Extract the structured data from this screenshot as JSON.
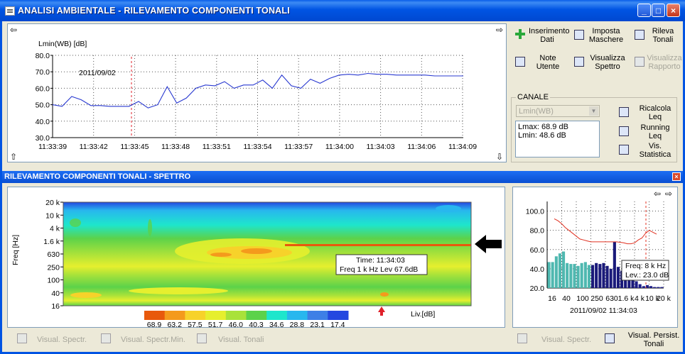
{
  "window": {
    "title": "ANALISI AMBIENTALE - RILEVAMENTO COMPONENTI TONALI",
    "minimize_label": "_",
    "maximize_label": "□",
    "close_label": "×"
  },
  "time_chart": {
    "ylabel": "Lmin(WB) [dB]",
    "date_marker_label": "2011/09/02",
    "y_ticks": [
      "80.0",
      "70.0",
      "60.0",
      "50.0",
      "40.0",
      "30.0"
    ],
    "x_ticks": [
      "11:33:39",
      "11:33:42",
      "11:33:45",
      "11:33:48",
      "11:33:51",
      "11:33:54",
      "11:33:57",
      "11:34:00",
      "11:34:03",
      "11:34:06",
      "11:34:09"
    ],
    "nav_left": "⇦",
    "nav_right": "⇨",
    "nav_up": "⇧",
    "nav_down": "⇩"
  },
  "toolbar": {
    "inserimento_dati": "Inserimento Dati",
    "imposta_maschere": "Imposta Maschere",
    "rileva_tonali": "Rileva Tonali",
    "note_utente": "Note Utente",
    "visualizza_spettro": "Visualizza Spettro",
    "visualizza_rapporto": "Visualizza Rapporto"
  },
  "canale": {
    "legend": "CANALE",
    "selected": "Lmin(WB)",
    "lmax": "Lmax: 68.9 dB",
    "lmin": "Lmin: 48.6 dB",
    "ricalcola_leq": "Ricalcola Leq",
    "running_leq": "Running Leq",
    "vis_statistica": "Vis. Statistica"
  },
  "spectrum_window": {
    "title": "RILEVAMENTO COMPONENTI TONALI - SPETTRO",
    "close_label": "×"
  },
  "spectrogram": {
    "ylabel": "Freq [Hz]",
    "y_ticks": [
      "20 k",
      "10 k",
      "4 k",
      "1.6 k",
      "630",
      "250",
      "100",
      "40",
      "16"
    ],
    "tooltip_line1": "Time: 11:34:03",
    "tooltip_line2": "Freq  1 k Hz Lev  67.6dB",
    "colorbar_labels": [
      "68.9",
      "63.2",
      "57.5",
      "51.7",
      "46.0",
      "40.3",
      "34.6",
      "28.8",
      "23.1",
      "17.4"
    ],
    "colorbar_colors": [
      "#e8590c",
      "#f49a1c",
      "#f7d22a",
      "#e6ef2e",
      "#a9e23a",
      "#5cd24a",
      "#1ee6cc",
      "#28b7ee",
      "#3e7fe6",
      "#2448e0"
    ],
    "unit_label": "Liv.[dB]"
  },
  "spectrum_chart": {
    "y_ticks": [
      "100.0",
      "80.0",
      "60.0",
      "40.0",
      "20.0"
    ],
    "x_ticks": [
      "16",
      "40",
      "100",
      "250",
      "630",
      "1.6 k",
      "4 k",
      "10 k",
      "20 k"
    ],
    "date_label": "2011/09/02 11:34:03",
    "tooltip_line1": "Freq: 8 k Hz",
    "tooltip_line2": "Lev.: 23.0 dB",
    "nav_left": "⇦",
    "nav_right": "⇨"
  },
  "bottom_bar": {
    "visual_spectr": "Visual. Spectr.",
    "visual_spectr_min": "Visual. Spectr.Min.",
    "visual_tonali": "Visual. Tonali",
    "visual_spectr_right": "Visual. Spectr.",
    "visual_persist_tonali": "Visual. Persist. Tonali"
  },
  "chart_data": [
    {
      "type": "line",
      "ylabel": "Lmin(WB) [dB]",
      "ylim": [
        30,
        80
      ],
      "x": [
        "11:33:39",
        "11:33:40",
        "11:33:41",
        "11:33:42",
        "11:33:43",
        "11:33:44",
        "11:33:45",
        "11:33:46",
        "11:33:47",
        "11:33:48",
        "11:33:49",
        "11:33:50",
        "11:33:51",
        "11:33:52",
        "11:33:53",
        "11:33:54",
        "11:33:55",
        "11:33:56",
        "11:33:57",
        "11:33:58",
        "11:33:59",
        "11:34:00",
        "11:34:01",
        "11:34:02",
        "11:34:03",
        "11:34:04",
        "11:34:05",
        "11:34:06",
        "11:34:07",
        "11:34:08",
        "11:34:09",
        "11:34:10"
      ],
      "values": [
        50,
        49,
        55,
        53,
        49.5,
        49.5,
        49,
        49,
        49,
        52,
        48,
        50,
        61,
        51,
        54,
        60,
        62,
        61.5,
        64,
        60,
        62,
        62,
        65,
        60,
        68,
        61.5,
        60,
        65.5,
        63,
        66,
        68,
        68.5,
        68,
        69,
        68.5,
        68.5,
        68,
        68,
        68,
        68,
        67.5,
        67.5,
        67.5,
        67.5
      ],
      "grid": true
    },
    {
      "type": "bar",
      "title": "",
      "categories": [
        "16",
        "20",
        "25",
        "31.5",
        "40",
        "50",
        "63",
        "80",
        "100",
        "125",
        "160",
        "200",
        "250",
        "315",
        "400",
        "500",
        "630",
        "800",
        "1 k",
        "1.25 k",
        "1.6 k",
        "2 k",
        "2.5 k",
        "3.15 k",
        "4 k",
        "5 k",
        "6.3 k",
        "8 k",
        "10 k",
        "12.5 k",
        "16 k",
        "20 k"
      ],
      "values": [
        47,
        47,
        53,
        56,
        58,
        46,
        45,
        45,
        43,
        46,
        47,
        44,
        44,
        46,
        45,
        46,
        43,
        40,
        68,
        42,
        38,
        36,
        34,
        32,
        27,
        24,
        22,
        23,
        22,
        21,
        21,
        21
      ],
      "line_values": [
        92,
        90,
        87,
        83,
        80,
        77,
        74,
        71,
        70,
        69,
        68,
        68,
        68,
        68,
        68,
        68,
        68,
        68,
        67.6,
        67,
        66,
        66,
        67,
        70,
        72,
        77,
        80,
        78,
        76
      ],
      "ylim": [
        20,
        110
      ],
      "grid": true
    }
  ]
}
